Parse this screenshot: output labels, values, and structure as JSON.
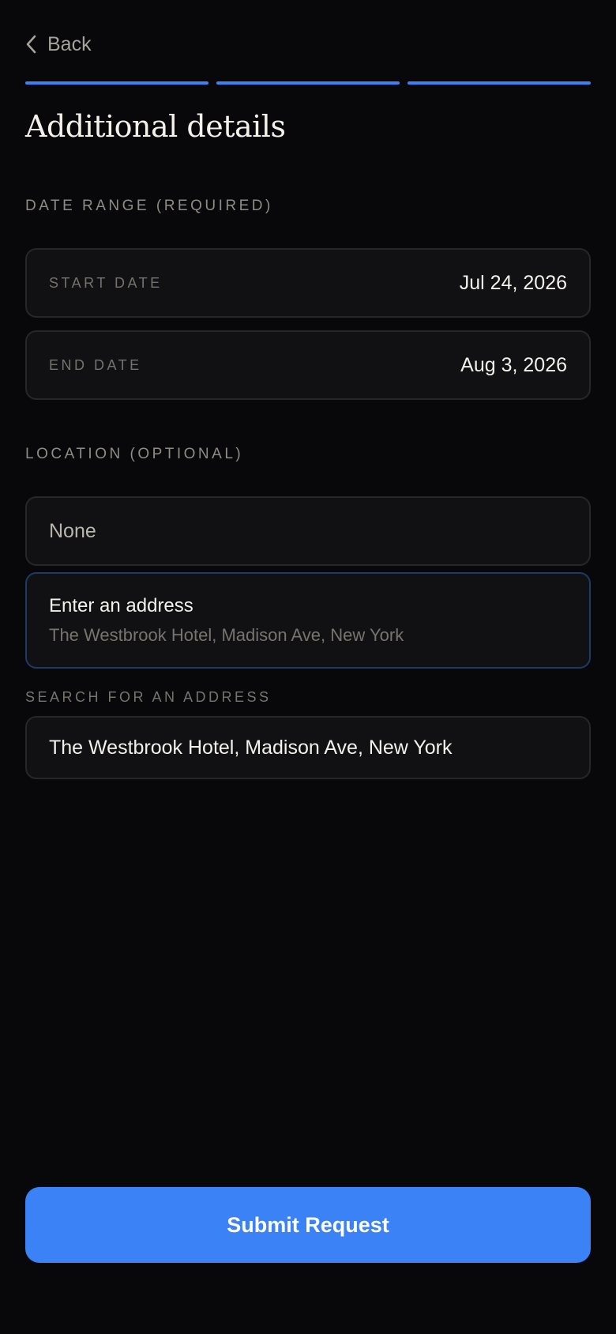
{
  "nav": {
    "back_label": "Back",
    "back_icon": "chevron-left-icon"
  },
  "progress": {
    "steps_total": 3,
    "steps_completed": 3,
    "color": "#3b82f6"
  },
  "page": {
    "title": "Additional details"
  },
  "date_range": {
    "section_label": "DATE RANGE (REQUIRED)",
    "start_label": "START DATE",
    "start_value": "Jul 24, 2026",
    "end_label": "END DATE",
    "end_value": "Aug 3, 2026"
  },
  "location": {
    "section_label": "LOCATION (OPTIONAL)",
    "none_label": "None",
    "address_title": "Enter an address",
    "address_subtitle": "The Westbrook Hotel, Madison Ave, New York",
    "selected_option": "Enter an address",
    "search_label": "SEARCH FOR AN ADDRESS",
    "search_value": "The Westbrook Hotel, Madison Ave, New York"
  },
  "actions": {
    "submit_label": "Submit Request",
    "accent_color": "#3b82f6"
  }
}
